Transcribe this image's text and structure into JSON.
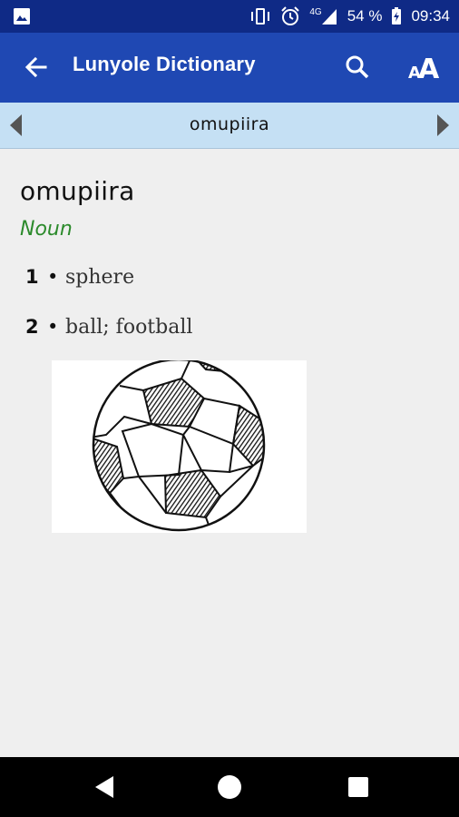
{
  "status_bar": {
    "network": "4G",
    "battery": "54 %",
    "time": "09:34"
  },
  "app_bar": {
    "title": "Lunyole Dictionary",
    "font_button": "AA"
  },
  "word_nav": {
    "current_word": "omupiira"
  },
  "entry": {
    "headword": "omupiira",
    "part_of_speech": "Noun",
    "senses": [
      {
        "number": "1",
        "bullet": "•",
        "gloss": "sphere"
      },
      {
        "number": "2",
        "bullet": "•",
        "gloss": "ball; football"
      }
    ],
    "picture": "soccer-ball-sketch"
  },
  "colors": {
    "status_bar": "#0f2a86",
    "app_bar": "#1f48b3",
    "word_nav": "#c5e0f4",
    "part_of_speech": "#2b8a2b",
    "background": "#efefef"
  }
}
